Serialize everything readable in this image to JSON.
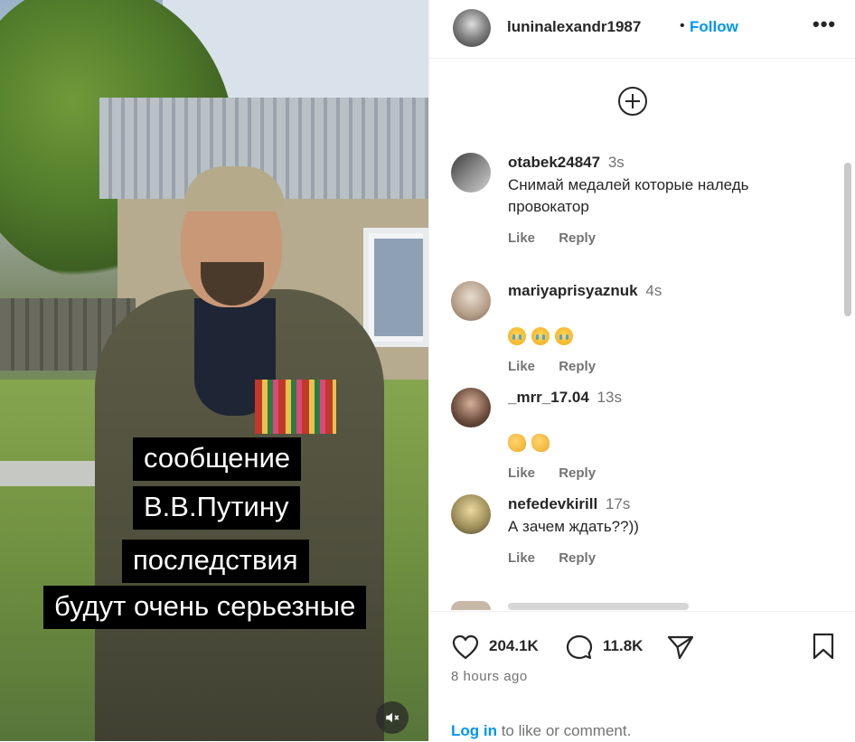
{
  "header": {
    "username": "luninalexandr1987",
    "separator": "•",
    "follow_label": "Follow",
    "more_label": "•••"
  },
  "video": {
    "caption_lines": [
      "сообщение",
      "В.В.Путину",
      "последствия",
      "будут очень серьезные"
    ],
    "muted_icon": "volume-muted-icon"
  },
  "comments": [
    {
      "username": "otabek24847",
      "time": "3s",
      "text": "Снимай медалей которые наледь\nпровокатор",
      "like_label": "Like",
      "reply_label": "Reply"
    },
    {
      "username": "mariyaprisyaznuk",
      "time": "4s",
      "emoji": [
        "crying-face",
        "crying-face",
        "crying-face"
      ],
      "like_label": "Like",
      "reply_label": "Reply"
    },
    {
      "username": "_mrr_17.04",
      "time": "13s",
      "emoji": [
        "clapping-hands",
        "clapping-hands"
      ],
      "like_label": "Like",
      "reply_label": "Reply"
    },
    {
      "username": "nefedevkirill",
      "time": "17s",
      "text": "А зачем ждать??))",
      "like_label": "Like",
      "reply_label": "Reply"
    }
  ],
  "footer": {
    "likes": "204.1K",
    "comments": "11.8K",
    "time_ago": "8 hours ago",
    "login_link": "Log in",
    "login_rest": " to like or comment."
  },
  "colors": {
    "link_blue": "#0095f6",
    "text": "#262626",
    "muted": "#737373"
  }
}
